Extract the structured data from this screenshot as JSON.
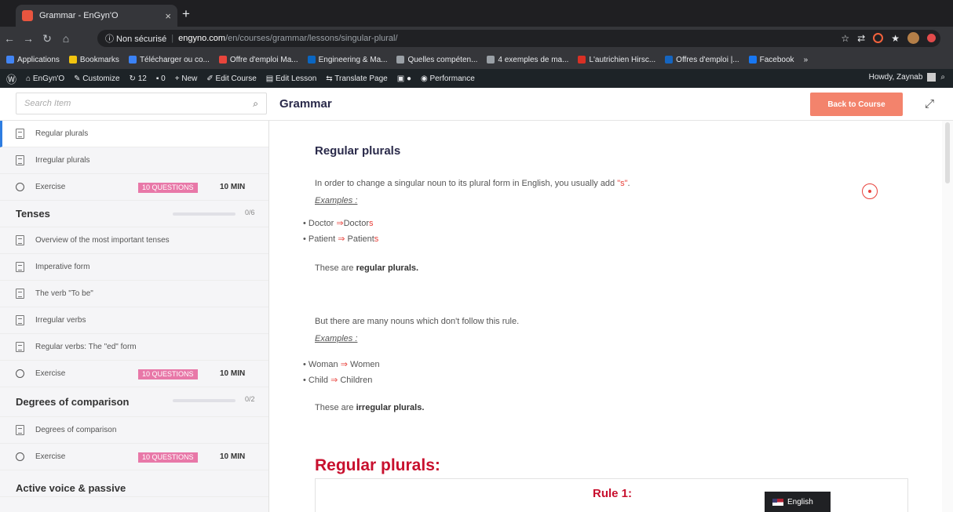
{
  "browser": {
    "tab_title": "Grammar - EnGyn'O",
    "tab_close": "×",
    "new_tab": "+",
    "security_label": "ⓘ Non sécurisé",
    "url_host": "engyno.com",
    "url_path": "/en/courses/grammar/lessons/singular-plural/"
  },
  "bookmarks": [
    {
      "label": "Applications",
      "icon": "apps-icon",
      "color": "#4285f4"
    },
    {
      "label": "Bookmarks",
      "icon": "star-icon",
      "color": "#f1c40f"
    },
    {
      "label": "Télécharger ou co...",
      "icon": "download-icon",
      "color": "#3b82f6"
    },
    {
      "label": "Offre d'emploi Ma...",
      "icon": "indeed-icon",
      "color": "#e8453c"
    },
    {
      "label": "Engineering & Ma...",
      "icon": "linkedin-icon",
      "color": "#0a66c2"
    },
    {
      "label": "Quelles compéten...",
      "icon": "link-icon",
      "color": "#9aa0a6"
    },
    {
      "label": "4 exemples de ma...",
      "icon": "link-icon",
      "color": "#9aa0a6"
    },
    {
      "label": "L'autrichien Hirsc...",
      "icon": "un-icon",
      "color": "#d93025"
    },
    {
      "label": "Offres d'emploi |...",
      "icon": "p-icon",
      "color": "#1565c0"
    },
    {
      "label": "Facebook",
      "icon": "facebook-icon",
      "color": "#1877f2"
    },
    {
      "label": "»",
      "icon": "more-icon",
      "color": "#35363a"
    }
  ],
  "wp_admin": {
    "site": "EnGyn'O",
    "customize": "Customize",
    "updates": "12",
    "comments": "0",
    "new": "New",
    "edit_course": "Edit Course",
    "edit_lesson": "Edit Lesson",
    "translate": "Translate Page",
    "performance": "Performance",
    "howdy": "Howdy, Zaynab"
  },
  "header": {
    "search_placeholder": "Search Item",
    "course_title": "Grammar",
    "back_button": "Back to Course"
  },
  "sidebar": {
    "items_top": [
      {
        "label": "Regular plurals"
      },
      {
        "label": "Irregular plurals"
      }
    ],
    "exercise_badge": "10 QUESTIONS",
    "exercise_duration": "10 MIN",
    "exercise_label": "Exercise",
    "tenses": {
      "title": "Tenses",
      "count": "0/6",
      "progress": 0,
      "items": [
        {
          "label": "Overview of the most important tenses"
        },
        {
          "label": "Imperative form"
        },
        {
          "label": "The verb \"To be\""
        },
        {
          "label": "Irregular verbs"
        },
        {
          "label": "Regular verbs: The \"ed\" form"
        }
      ]
    },
    "degrees": {
      "title": "Degrees of comparison",
      "count": "0/2",
      "progress": 0,
      "items": [
        {
          "label": "Degrees of comparison"
        }
      ]
    },
    "next_section": "Active voice & passive"
  },
  "content": {
    "lesson_title": "Regular plurals",
    "intro_text": "In order to change a singular noun to its plural form in English, you usually add ",
    "intro_highlight": "\"s\"",
    "intro_end": ".",
    "examples_label": "Examples :",
    "regular_examples": [
      {
        "from": "Doctor",
        "to_base": "Doctor",
        "to_suffix": "s"
      },
      {
        "from": "Patient",
        "to_base": "Patient",
        "to_suffix": "s"
      }
    ],
    "regular_note_prefix": "These are ",
    "regular_note_bold": "regular plurals.",
    "exception_text": "But there are many nouns which don't follow this rule.",
    "irregular_examples": [
      {
        "from": "Woman",
        "to": "Women"
      },
      {
        "from": "Child",
        "to": "Children"
      }
    ],
    "irregular_note_prefix": "These are ",
    "irregular_note_bold": "irregular plurals.",
    "big_title": "Regular plurals:",
    "rule_title": "Rule 1:"
  },
  "language": "English"
}
